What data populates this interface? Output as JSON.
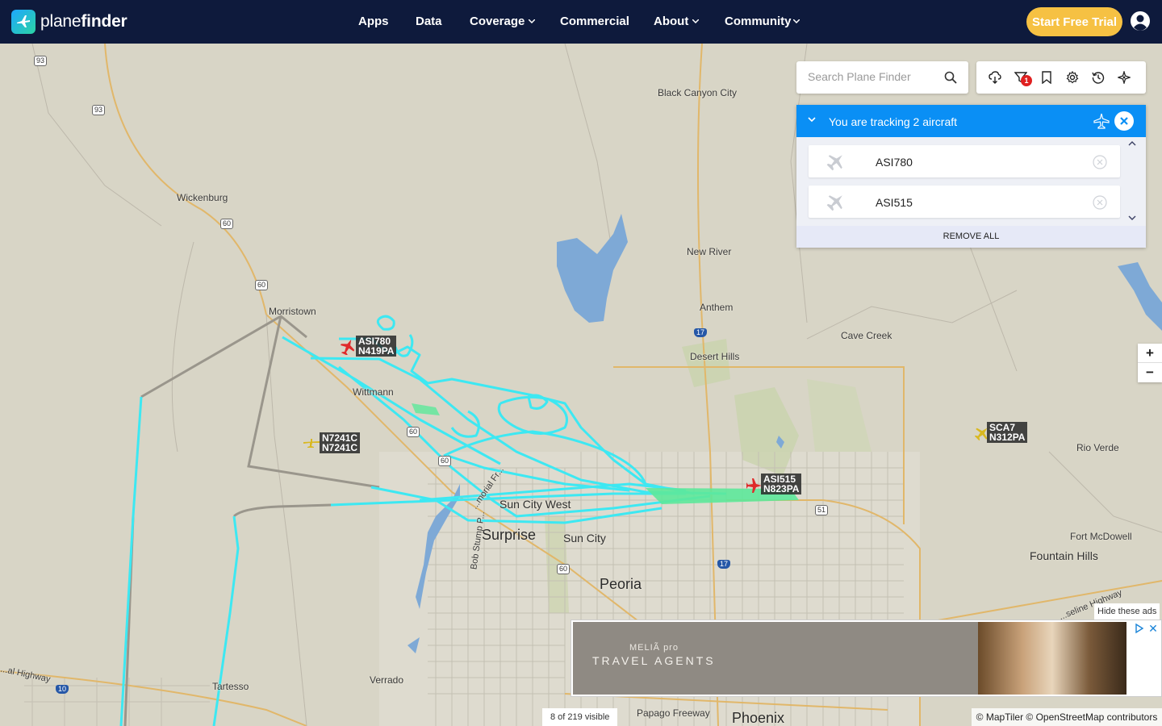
{
  "brand": {
    "prefix": "plane",
    "suffix": "finder"
  },
  "nav": [
    {
      "label": "Apps"
    },
    {
      "label": "Data"
    },
    {
      "label": "Coverage"
    },
    {
      "label": "Commercial"
    },
    {
      "label": "About"
    },
    {
      "label": "Community"
    }
  ],
  "cta": {
    "label": "Start Free Trial"
  },
  "search": {
    "placeholder": "Search Plane Finder"
  },
  "toolbar": {
    "filter_badge": "1"
  },
  "tracking": {
    "title": "You are tracking 2 aircraft",
    "rows": [
      {
        "callsign": "ASI780"
      },
      {
        "callsign": "ASI515"
      }
    ],
    "remove_all": "REMOVE ALL"
  },
  "zoom": {
    "in": "+",
    "out": "−"
  },
  "aircraft": [
    {
      "callsign": "ASI780",
      "reg": "N419PA"
    },
    {
      "callsign": "N7241C",
      "reg": "N7241C"
    },
    {
      "callsign": "ASI515",
      "reg": "N823PA"
    },
    {
      "callsign": "SCA7",
      "reg": "N312PA"
    }
  ],
  "places": {
    "black_canyon_city": "Black Canyon City",
    "wickenburg": "Wickenburg",
    "new_river": "New River",
    "morristown": "Morristown",
    "anthem": "Anthem",
    "cave_creek": "Cave Creek",
    "desert_hills": "Desert Hills",
    "wittmann": "Wittmann",
    "rio_verde": "Rio Verde",
    "sun_city_west": "Sun City West",
    "surprise": "Surprise",
    "sun_city": "Sun City",
    "fort_mcdowell": "Fort McDowell",
    "fountain_hills": "Fountain Hills",
    "peoria": "Peoria",
    "tartesso": "Tartesso",
    "verrado": "Verrado",
    "papago_freeway": "Papago Freeway",
    "phoenix": "Phoenix",
    "bob_stump": "Bob Stump P...",
    "grand_ave": "...morial Fr...",
    "beeline": "...seline Highway",
    "west_highway": "...al Highway"
  },
  "shields": {
    "us93a": "93",
    "us93b": "93",
    "us60a": "60",
    "us60b": "60",
    "us60c": "60",
    "us60d": "60",
    "us60e": "60",
    "sr51": "51",
    "i17a": "17",
    "i17b": "17",
    "i10": "10"
  },
  "ad": {
    "brand": "MELIÃ pro",
    "tagline": "TRAVEL AGENTS",
    "hide": "Hide these ads",
    "close": "✕"
  },
  "status": {
    "visible": "8 of 219 visible"
  },
  "attribution": "© MapTiler © OpenStreetMap contributors"
}
